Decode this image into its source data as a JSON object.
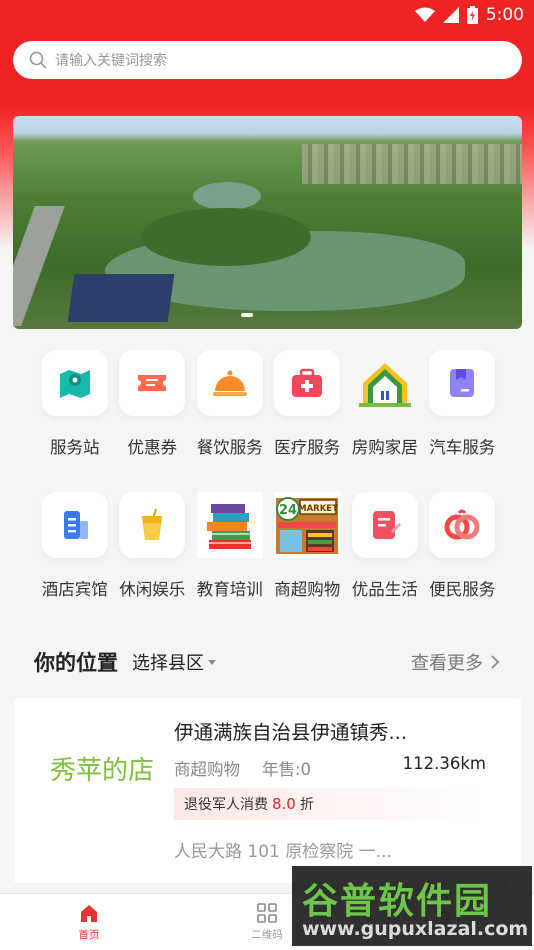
{
  "status_bar": {
    "time": "5:00"
  },
  "search": {
    "placeholder": "请输入关键词搜索"
  },
  "categories_row1": [
    {
      "label": "服务站",
      "icon": "map-pin-icon",
      "color": "#18b9a8"
    },
    {
      "label": "优惠券",
      "icon": "coupon-icon",
      "color": "#ff6b4a"
    },
    {
      "label": "餐饮服务",
      "icon": "food-cloche-icon",
      "color": "#ff8a2b"
    },
    {
      "label": "医疗服务",
      "icon": "medical-kit-icon",
      "color": "#f0485a"
    },
    {
      "label": "房购家居",
      "icon": "house-icon",
      "color": "#3a9a3a"
    },
    {
      "label": "汽车服务",
      "icon": "car-service-icon",
      "color": "#7a6cf0"
    }
  ],
  "categories_row2": [
    {
      "label": "酒店宾馆",
      "icon": "hotel-building-icon",
      "color": "#3a7af0"
    },
    {
      "label": "休闲娱乐",
      "icon": "drink-cup-icon",
      "color": "#f5b020"
    },
    {
      "label": "教育培训",
      "icon": "books-stack-icon",
      "color": "#3aa04a"
    },
    {
      "label": "商超购物",
      "icon": "market-store-icon",
      "color": "#e6a020"
    },
    {
      "label": "优品生活",
      "icon": "document-pen-icon",
      "color": "#f05060"
    },
    {
      "label": "便民服务",
      "icon": "rings-icon",
      "color": "#f04848"
    }
  ],
  "market_sign": {
    "top": "24",
    "word": "MARKET"
  },
  "location": {
    "title": "你的位置",
    "select_label": "选择县区",
    "more_label": "查看更多"
  },
  "store": {
    "logo_text": "秀苹的店",
    "name": "伊通满族自治县伊通镇秀...",
    "category": "商超购物",
    "sales": "年售:0",
    "distance": "112.36km",
    "discount_prefix": "退役军人消费",
    "discount_value": "8.0",
    "discount_suffix": "折",
    "address": "人民大路 101 原检察院 一..."
  },
  "tabs": [
    {
      "label": "首页",
      "icon": "home-icon",
      "active": true
    },
    {
      "label": "二维码",
      "icon": "qrcode-icon",
      "active": false
    },
    {
      "label": "",
      "icon": "user-icon",
      "active": false
    }
  ],
  "watermark": {
    "title": "谷普软件园",
    "url": "www.gupuxlazal.com"
  },
  "colors": {
    "brand_red": "#ef2323",
    "active_tab": "#e53333"
  }
}
